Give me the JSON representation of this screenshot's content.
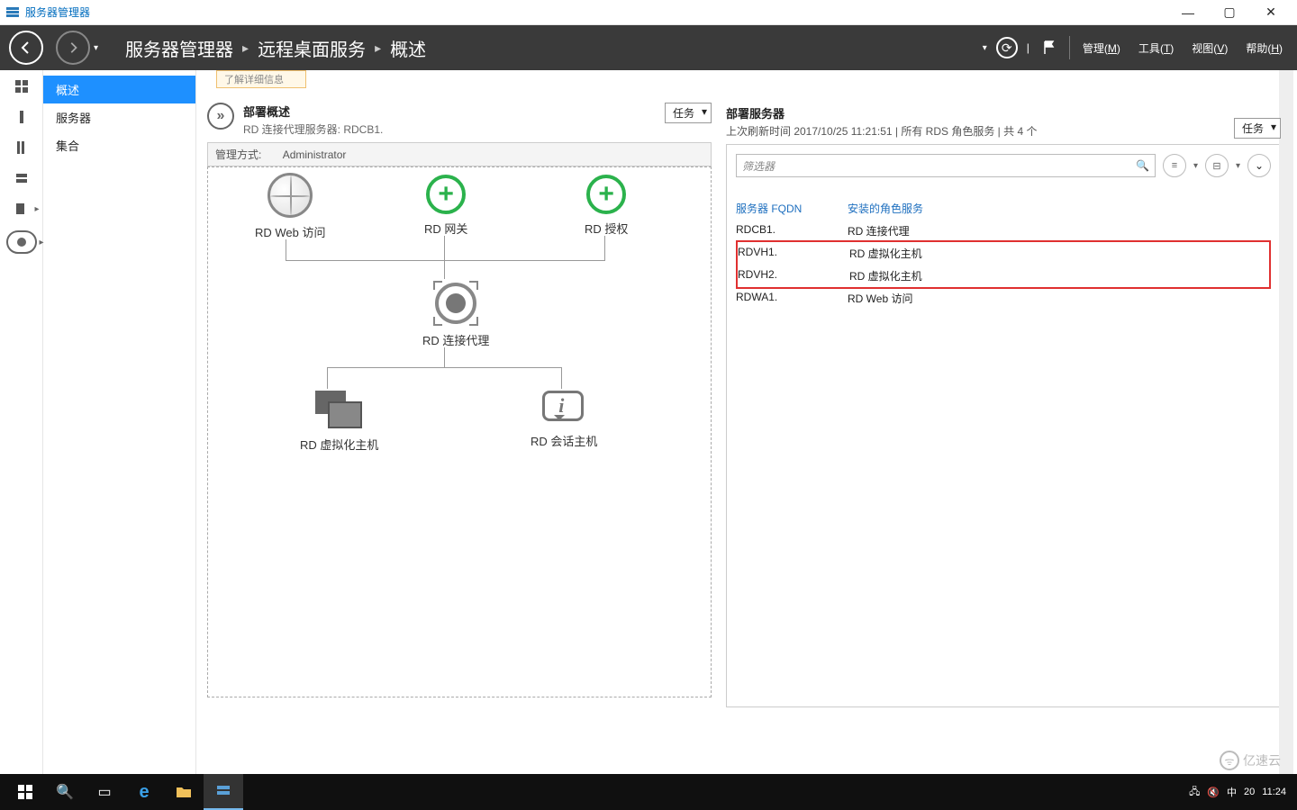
{
  "app": {
    "title": "服务器管理器"
  },
  "window_controls": {
    "min": "—",
    "max": "▢",
    "close": "✕"
  },
  "breadcrumbs": {
    "root": "服务器管理器",
    "mid": "远程桌面服务",
    "leaf": "概述",
    "sep": "▸"
  },
  "header_menu": {
    "manage": "管理",
    "manage_u": "M",
    "tools": "工具",
    "tools_u": "T",
    "view": "视图",
    "view_u": "V",
    "help": "帮助",
    "help_u": "H",
    "refresh_caret": "▾",
    "pipe": "|"
  },
  "sidebar": {
    "items": [
      {
        "label": "概述"
      },
      {
        "label": "服务器"
      },
      {
        "label": "集合"
      }
    ]
  },
  "info_banner": "了解详细信息",
  "deployment": {
    "title": "部署概述",
    "subtitle": "RD 连接代理服务器: RDCB1.",
    "tasks": "任务",
    "admin_line_key": "管理方式:",
    "admin_line_val": "Administrator",
    "nodes": {
      "web": "RD Web 访问",
      "gateway": "RD 网关",
      "license": "RD 授权",
      "broker": "RD 连接代理",
      "vm": "RD 虚拟化主机",
      "session": "RD 会话主机"
    }
  },
  "servers": {
    "title": "部署服务器",
    "subtitle": "上次刷新时间 2017/10/25 11:21:51 | 所有 RDS 角色服务  | 共 4 个",
    "tasks": "任务",
    "filter_placeholder": "筛选器",
    "columns": {
      "fqdn": "服务器 FQDN",
      "role": "安装的角色服务"
    },
    "rows": [
      {
        "fqdn": "RDCB1.",
        "role": "RD 连接代理",
        "hl": false
      },
      {
        "fqdn": "RDVH1.",
        "role": "RD 虚拟化主机",
        "hl": true
      },
      {
        "fqdn": "RDVH2.",
        "role": "RD 虚拟化主机",
        "hl": true
      },
      {
        "fqdn": "RDWA1.",
        "role": "RD Web 访问",
        "hl": false
      }
    ]
  },
  "taskbar": {
    "time": "11:24",
    "date_partial": "20",
    "ime": "中",
    "watermark": "亿速云"
  }
}
